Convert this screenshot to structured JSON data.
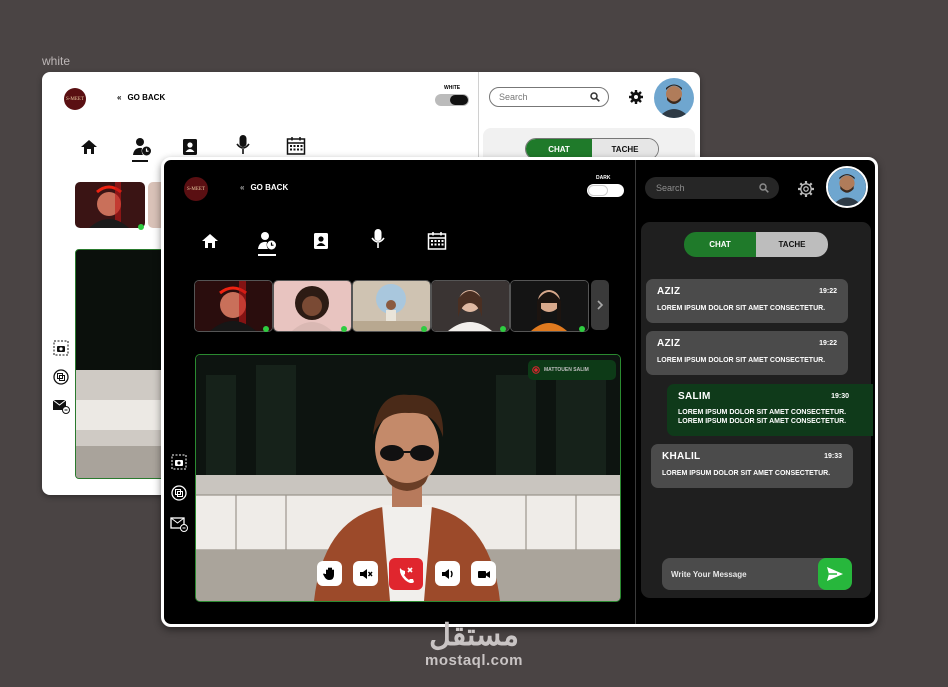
{
  "caption": "white",
  "light": {
    "logo": "S-MEET",
    "go_back": "GO BACK",
    "theme_label": "WHITE",
    "search_placeholder": "Search",
    "tabs": [
      "CHAT",
      "TACHE"
    ]
  },
  "dark": {
    "logo": "S-MEET",
    "go_back": "GO BACK",
    "theme_label": "DARK",
    "search_placeholder": "Search",
    "tabs": {
      "chat": "CHAT",
      "tache": "TACHE"
    },
    "speaker_badge": "MATTOUEN SALIM",
    "messages": [
      {
        "name": "AZIZ",
        "time": "19:22",
        "text": "LOREM IPSUM DOLOR SIT AMET CONSECTETUR."
      },
      {
        "name": "AZIZ",
        "time": "19:22",
        "text": "LOREM IPSUM DOLOR SIT AMET CONSECTETUR."
      },
      {
        "name": "SALIM",
        "time": "19:30",
        "text": "LOREM IPSUM DOLOR SIT AMET CONSECTETUR.",
        "text2": "LOREM IPSUM DOLOR SIT AMET CONSECTETUR."
      },
      {
        "name": "KHALIL",
        "time": "19:33",
        "text": "LOREM IPSUM DOLOR SIT AMET CONSECTETUR."
      }
    ],
    "message_placeholder": "Write Your Message"
  },
  "watermark": {
    "arabic": "مستقل",
    "latin": "mostaql.com"
  },
  "colors": {
    "accent_green": "#1f7a2a",
    "online_dot": "#2ecc40",
    "end_call_red": "#e0262e",
    "send_green": "#27b73c"
  },
  "icons": [
    "home-icon",
    "user-clock-icon",
    "contacts-icon",
    "microphone-icon",
    "calendar-icon",
    "settings-icon",
    "search-icon",
    "screenshot-icon",
    "copy-icon",
    "mail-share-icon",
    "hand-icon",
    "mute-icon",
    "end-call-icon",
    "volume-icon",
    "camera-icon",
    "send-icon",
    "chevron-right-icon"
  ]
}
